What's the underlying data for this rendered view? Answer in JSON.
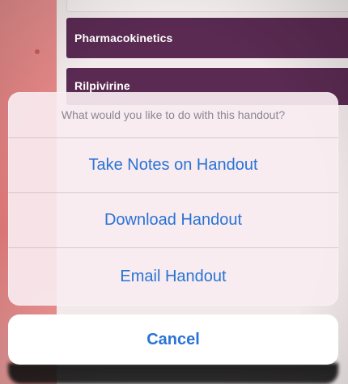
{
  "list": {
    "items": [
      {
        "label": "Pharmacokinetics"
      },
      {
        "label": "Rilpivirine"
      }
    ]
  },
  "action_sheet": {
    "title": "What would you like to do with this handout?",
    "actions": [
      {
        "label": "Take Notes on Handout"
      },
      {
        "label": "Download Handout"
      },
      {
        "label": "Email Handout"
      }
    ],
    "cancel_label": "Cancel"
  },
  "colors": {
    "accent": "#2a73d6",
    "list_item_bg": "#5a2a52",
    "sidebar": "#e27a7a"
  }
}
